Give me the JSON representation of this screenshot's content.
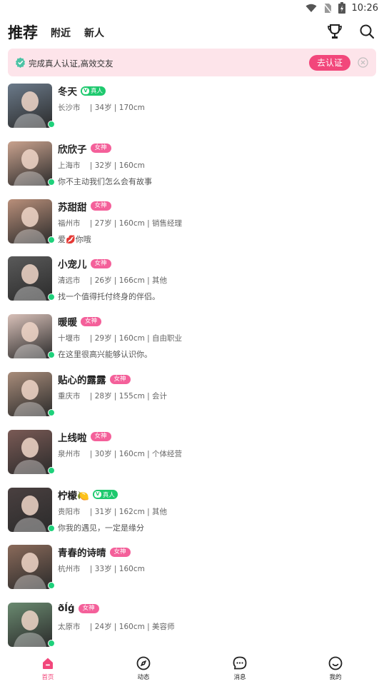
{
  "status_bar": {
    "time": "10:26"
  },
  "header": {
    "tab_recommend": "推荐",
    "tab_nearby": "附近",
    "tab_new": "新人"
  },
  "banner": {
    "text": "完成真人认证,高效交友",
    "button": "去认证"
  },
  "badges": {
    "real": "真人",
    "goddess": "女神"
  },
  "users": [
    {
      "name": "冬天",
      "badge": "real",
      "info": "长沙市    | 34岁 | 170cm",
      "bio": "",
      "avatar_bg": "#6b7a8a"
    },
    {
      "name": "欣欣子",
      "badge": "goddess",
      "info": "上海市    | 32岁 | 160cm",
      "bio": "你不主动我们怎么会有故事",
      "avatar_bg": "#c9a28e"
    },
    {
      "name": "苏甜甜",
      "badge": "goddess",
      "info": "福州市    | 27岁 | 160cm | 销售经理",
      "bio": "爱💋你哦",
      "avatar_bg": "#b98f7a"
    },
    {
      "name": "小宠儿",
      "badge": "goddess",
      "info": "清远市    | 26岁 | 166cm | 其他",
      "bio": "找一个值得托付终身的伴侣。",
      "avatar_bg": "#5a5a5a"
    },
    {
      "name": "暖暖",
      "badge": "goddess",
      "info": "十堰市    | 29岁 | 160cm | 自由职业",
      "bio": "在这里很高兴能够认识你。",
      "avatar_bg": "#d8c0b8"
    },
    {
      "name": "贴心的露露",
      "badge": "goddess",
      "info": "重庆市    | 28岁 | 155cm | 会计",
      "bio": "",
      "avatar_bg": "#a88c7a"
    },
    {
      "name": "上线啦",
      "badge": "goddess",
      "info": "泉州市    | 30岁 | 160cm | 个体经营",
      "bio": "",
      "avatar_bg": "#7a5a55"
    },
    {
      "name": "柠檬🍋",
      "badge": "real",
      "info": "贵阳市    | 31岁 | 162cm | 其他",
      "bio": "你我的遇见，一定是缘分",
      "avatar_bg": "#4a4040"
    },
    {
      "name": "青春的诗晴",
      "badge": "goddess",
      "info": "杭州市    | 33岁 | 160cm",
      "bio": "",
      "avatar_bg": "#8a6a5a"
    },
    {
      "name": "ðĺģ",
      "badge": "goddess",
      "info": "太原市    | 24岁 | 160cm | 美容师",
      "bio": "",
      "avatar_bg": "#6a8a70"
    }
  ],
  "nav": {
    "home": "首页",
    "feed": "动态",
    "messages": "消息",
    "me": "我的"
  },
  "colors": {
    "accent": "#f2477b",
    "online": "#1fd17b",
    "real_badge": "#1ec96e",
    "goddess_badge": "#f4609a",
    "banner_bg": "#fde4ea"
  }
}
